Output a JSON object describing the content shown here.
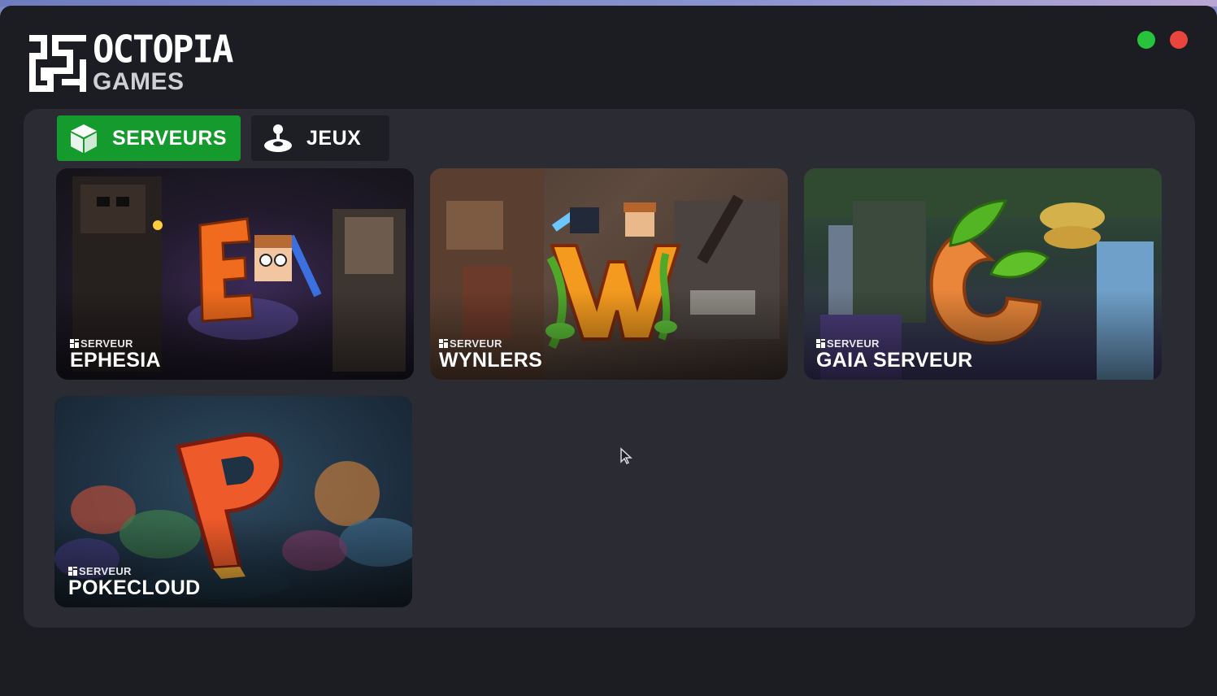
{
  "app": {
    "logo_title": "OCTOPIA",
    "logo_subtitle": "GAMES"
  },
  "window_controls": [
    {
      "name": "minimize",
      "color": "#27c33d"
    },
    {
      "name": "close",
      "color": "#e8453c"
    }
  ],
  "tabs": [
    {
      "label": "SERVEURS",
      "icon": "cube-icon",
      "active": true,
      "color": "#159a2e"
    },
    {
      "label": "JEUX",
      "icon": "joystick-icon",
      "active": false
    }
  ],
  "servers": [
    {
      "kind": "SERVEUR",
      "name": "EPHESIA",
      "letter": "E"
    },
    {
      "kind": "SERVEUR",
      "name": "WYNLERS",
      "letter": "W"
    },
    {
      "kind": "SERVEUR",
      "name": "GAIA SERVEUR",
      "letter": "G"
    },
    {
      "kind": "SERVEUR",
      "name": "POKECLOUD",
      "letter": "P"
    }
  ]
}
